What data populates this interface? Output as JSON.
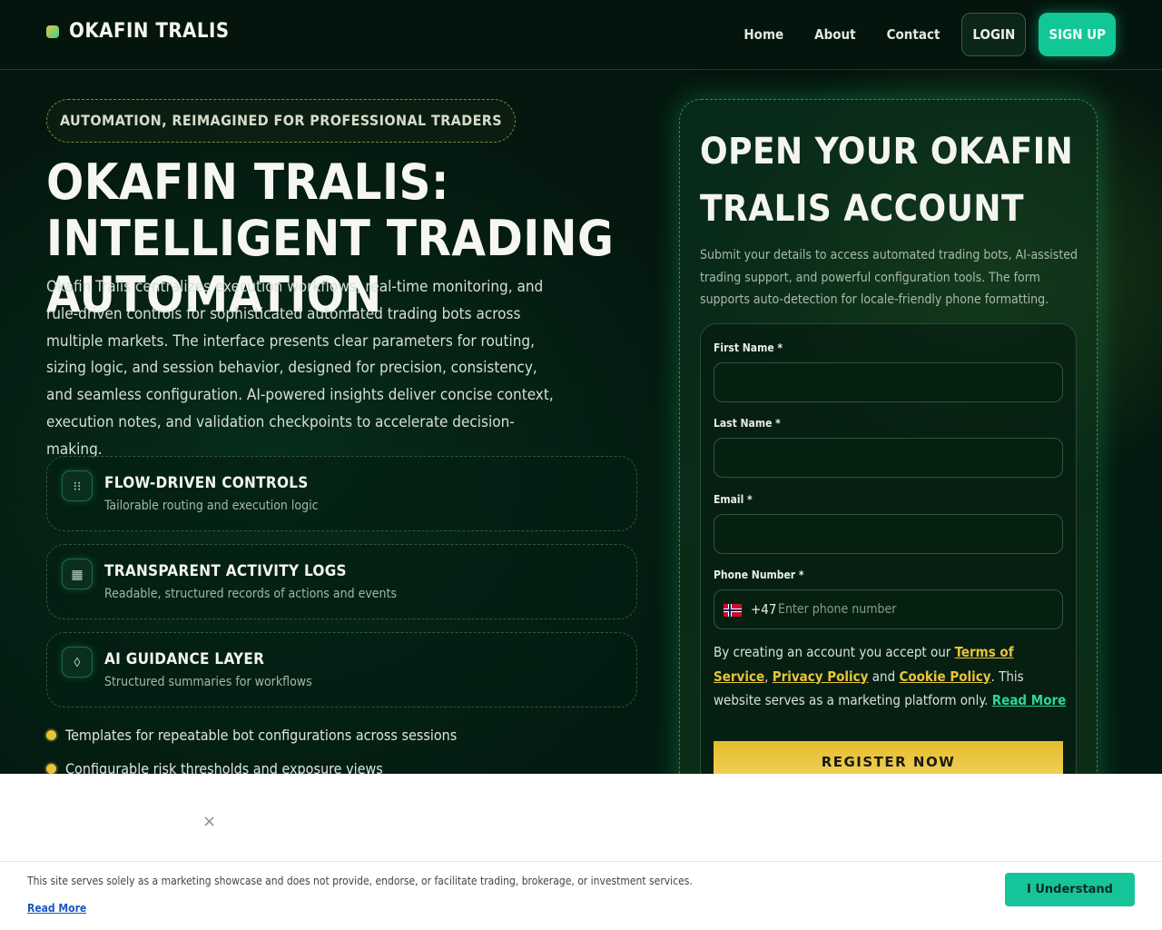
{
  "header": {
    "brand": "OKAFIN TRALIS",
    "nav": {
      "home": "Home",
      "about": "About",
      "contact": "Contact"
    },
    "login": "LOGIN",
    "signup": "SIGN UP"
  },
  "hero": {
    "pill": "AUTOMATION, REIMAGINED FOR PROFESSIONAL TRADERS",
    "title": "OKAFIN TRALIS: INTELLIGENT TRADING AUTOMATION",
    "description": "Okafin Tralis centralizes execution workflows, real-time monitoring, and rule-driven controls for sophisticated automated trading bots across multiple markets. The interface presents clear parameters for routing, sizing logic, and session behavior, designed for precision, consistency, and seamless configuration. AI-powered insights deliver concise context, execution notes, and validation checkpoints to accelerate decision-making.",
    "features": [
      {
        "icon": "flow-icon",
        "title": "FLOW-DRIVEN CONTROLS",
        "subtitle": "Tailorable routing and execution logic"
      },
      {
        "icon": "log-icon",
        "title": "TRANSPARENT ACTIVITY LOGS",
        "subtitle": "Readable, structured records of actions and events"
      },
      {
        "icon": "diamond-icon",
        "title": "AI GUIDANCE LAYER",
        "subtitle": "Structured summaries for workflows"
      }
    ],
    "bullets": [
      "Templates for repeatable bot configurations across sessions",
      "Configurable risk thresholds and exposure views"
    ]
  },
  "form": {
    "title": "OPEN YOUR OKAFIN TRALIS ACCOUNT",
    "description": "Submit your details to access automated trading bots, AI-assisted trading support, and powerful configuration tools. The form supports auto-detection for locale-friendly phone formatting.",
    "first_name_label": "First Name *",
    "last_name_label": "Last Name *",
    "email_label": "Email *",
    "phone_label": "Phone Number *",
    "dial_code": "+47",
    "phone_placeholder": "Enter phone number",
    "consent": {
      "prefix": "By creating an account you accept our ",
      "terms": "Terms of Service",
      "comma": ",",
      "privacy": "Privacy Policy",
      "and": " and ",
      "cookie": "Cookie Policy",
      "suffix": ". This website serves as a marketing platform only. ",
      "read_more": "Read More"
    },
    "submit": "REGISTER NOW"
  },
  "cookie_banner": {
    "close": "×",
    "text": "This site serves solely as a marketing showcase and does not provide, endorse, or facilitate trading, brokerage, or investment services.",
    "read_more": "Read More",
    "button": "I Understand"
  },
  "colors": {
    "background": "#031a10",
    "accent_green": "#12c796",
    "accent_yellow": "#e8c33a"
  }
}
